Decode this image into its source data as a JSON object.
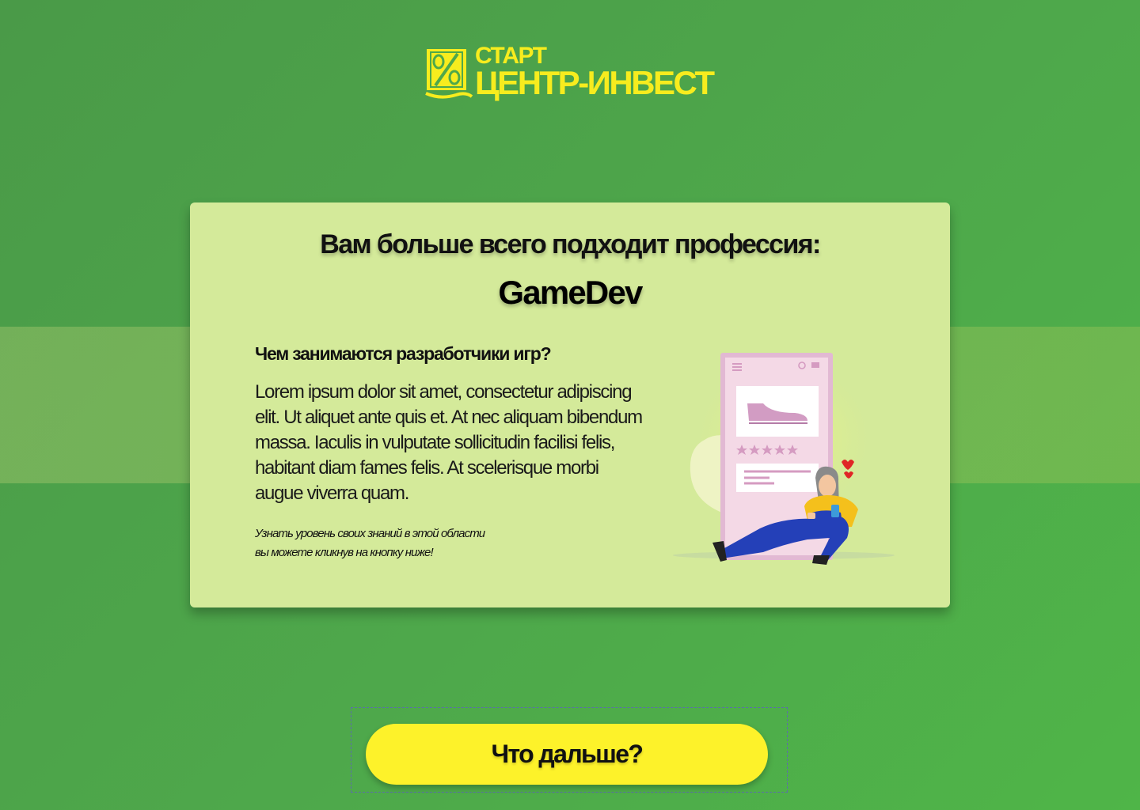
{
  "logo": {
    "line1": "СТАРТ",
    "line2": "ЦЕНТР-ИНВЕСТ",
    "icon": "percent-coin-icon",
    "color": "#f7ec1e"
  },
  "card": {
    "title": "Вам больше всего подходит профессия:",
    "profession": "GameDev",
    "subheading": "Чем занимаются разработчики игр?",
    "body": "Lorem ipsum dolor sit amet, consectetur adipiscing elit. Ut aliquet ante quis et. At nec aliquam bibendum massa. Iaculis in vulputate sollicitudin facilisi felis, habitant diam fames felis. At scelerisque morbi augue viverra quam.",
    "note_line1": "Узнать уровень своих знаний в этой области",
    "note_line2": "вы можете кликнув на кнопку ниже!",
    "background": "#d4ea9a",
    "illustration": "shopping-app-girl-illustration"
  },
  "next_button": {
    "label": "Что дальше?",
    "color": "#fdf22a"
  },
  "colors": {
    "background": "#4ea84b",
    "accent": "#f7ec1e"
  }
}
